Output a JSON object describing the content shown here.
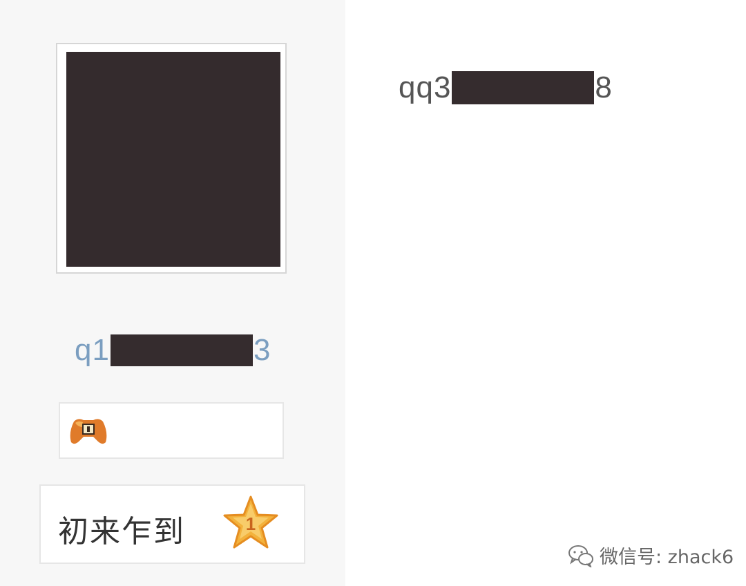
{
  "sidebar": {
    "username_prefix": "q1",
    "username_suffix": "3",
    "rank_label": "初来乍到",
    "rank_level": "1"
  },
  "profile": {
    "name_prefix": "qq3",
    "name_suffix": "8"
  },
  "watermark": {
    "text": "微信号: zhack6"
  },
  "icons": {
    "medal": "gamepad-icon",
    "rank": "star-icon",
    "watermark": "wechat-icon"
  },
  "colors": {
    "username": "#7b9ec0",
    "redaction": "#352c2e",
    "star": "#f3b23c"
  }
}
